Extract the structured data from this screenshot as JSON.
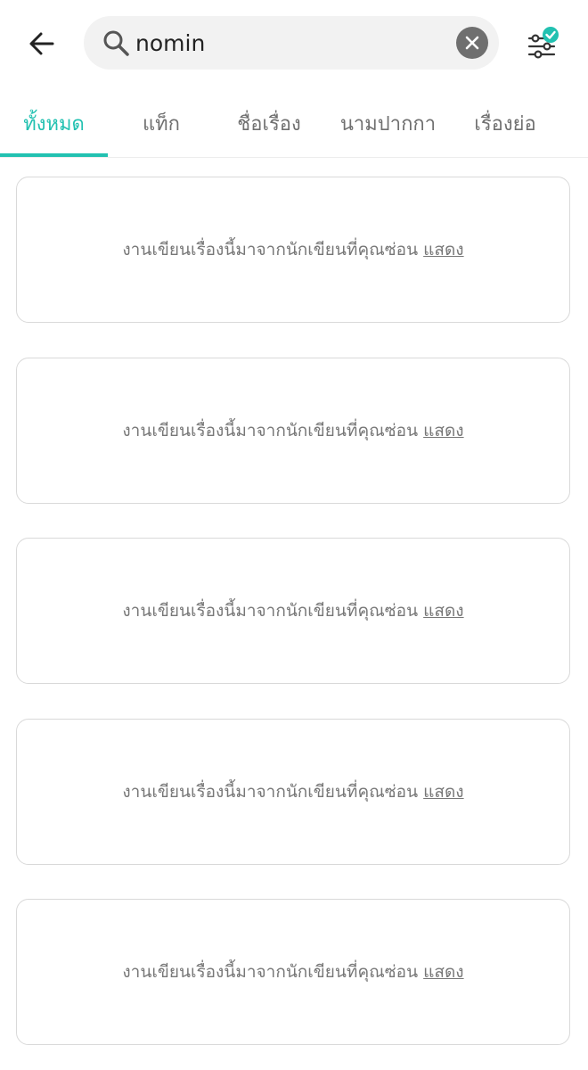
{
  "header": {
    "back_icon": "arrow-left-icon",
    "search": {
      "value": "nomin",
      "icon": "search-icon",
      "clear_icon": "clear-circle-icon"
    },
    "filter_icon": "filter-sliders-check-icon",
    "accent_color": "#22c1b1"
  },
  "tabs": [
    {
      "label": "ทั้งหมด",
      "active": true
    },
    {
      "label": "แท็ก",
      "active": false
    },
    {
      "label": "ชื่อเรื่อง",
      "active": false
    },
    {
      "label": "นามปากกา",
      "active": false
    },
    {
      "label": "เรื่องย่อ",
      "active": false
    }
  ],
  "results": [
    {
      "message": "งานเขียนเรื่องนี้มาจากนักเขียนที่คุณซ่อน",
      "link": "แสดง"
    },
    {
      "message": "งานเขียนเรื่องนี้มาจากนักเขียนที่คุณซ่อน",
      "link": "แสดง"
    },
    {
      "message": "งานเขียนเรื่องนี้มาจากนักเขียนที่คุณซ่อน",
      "link": "แสดง"
    },
    {
      "message": "งานเขียนเรื่องนี้มาจากนักเขียนที่คุณซ่อน",
      "link": "แสดง"
    },
    {
      "message": "งานเขียนเรื่องนี้มาจากนักเขียนที่คุณซ่อน",
      "link": "แสดง"
    }
  ]
}
